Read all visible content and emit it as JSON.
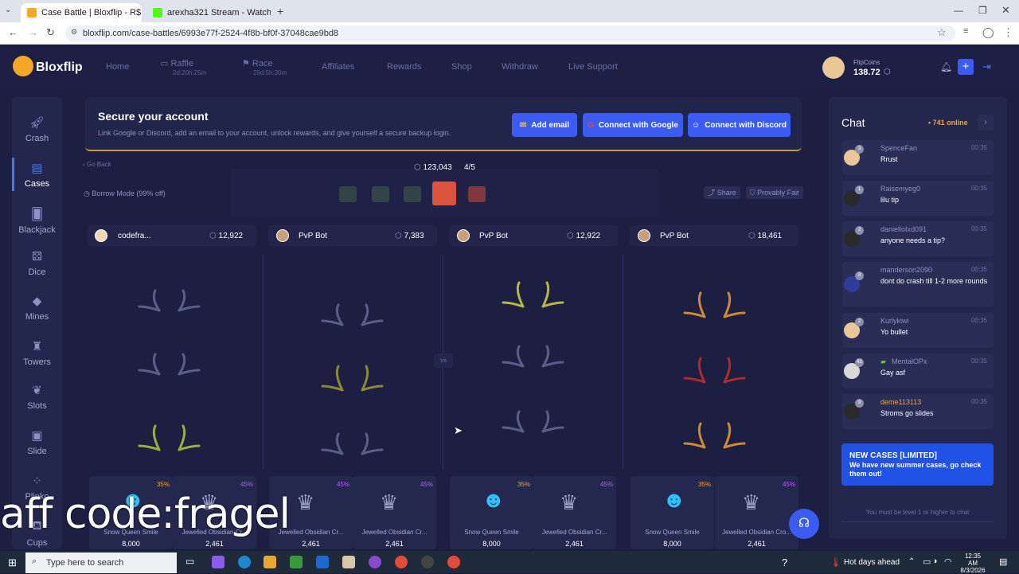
{
  "browser": {
    "tabs": [
      {
        "label": "Case Battle | Bloxflip - R$ S",
        "active": true
      },
      {
        "label": "arexha321 Stream - Watch Live",
        "active": false
      }
    ],
    "url": "bloxflip.com/case-battles/6993e77f-2524-4f8b-bf0f-37048cae9bd8"
  },
  "site": {
    "logo": "Bloxflip",
    "nav": [
      {
        "label": "Home"
      },
      {
        "label": "Raffle",
        "sub": "2d:20h:25m"
      },
      {
        "label": "Race",
        "sub": "29d:5h:20m"
      },
      {
        "label": "Affiliates"
      },
      {
        "label": "Rewards"
      },
      {
        "label": "Shop"
      },
      {
        "label": "Withdraw"
      },
      {
        "label": "Live Support"
      }
    ],
    "wallet": {
      "label": "FlipCoins",
      "amount": "138.72"
    },
    "sidebar": [
      {
        "label": "Crash",
        "icon": "rocket-icon"
      },
      {
        "label": "Cases",
        "icon": "case-icon",
        "active": true
      },
      {
        "label": "Blackjack",
        "icon": "cards-icon"
      },
      {
        "label": "Dice",
        "icon": "dice-icon"
      },
      {
        "label": "Mines",
        "icon": "gem-icon"
      },
      {
        "label": "Towers",
        "icon": "tower-icon"
      },
      {
        "label": "Slots",
        "icon": "cherry-icon"
      },
      {
        "label": "Slide",
        "icon": "slide-icon"
      },
      {
        "label": "Plinko",
        "icon": "plinko-icon"
      },
      {
        "label": "Cups",
        "icon": "cup-icon"
      }
    ],
    "secure": {
      "title": "Secure your account",
      "desc": "Link Google or Discord, add an email to your account, unlock rewards, and give yourself a secure backup login.",
      "btn_email": "Add email",
      "btn_google": "Connect with Google",
      "btn_discord": "Connect with Discord"
    },
    "battle": {
      "go_back": "Go Back",
      "total": "123,043",
      "round": "4/5",
      "borrow": "Borrow Mode (99% off)",
      "share": "Share",
      "fair": "Provably Fair",
      "vs": "vs",
      "players": [
        {
          "name": "codefra...",
          "value": "12,922"
        },
        {
          "name": "PvP Bot",
          "value": "7,383"
        },
        {
          "name": "PvP Bot",
          "value": "12,922"
        },
        {
          "name": "PvP Bot",
          "value": "18,461"
        }
      ],
      "items": [
        {
          "name": "Snow Queen Smile",
          "value": "8,000",
          "pct": "35%",
          "purple": false
        },
        {
          "name": "Jewelled Obsidian Cr...",
          "value": "2,461",
          "pct": "45%",
          "purple": true
        },
        {
          "name": "Jewelled Obsidian Cr...",
          "value": "2,461",
          "pct": "45%",
          "purple": true
        },
        {
          "name": "Jewelled Obsidian Cr...",
          "value": "2,461",
          "pct": "45%",
          "purple": true
        },
        {
          "name": "Snow Queen Smile",
          "value": "8,000",
          "pct": "35%",
          "purple": false
        },
        {
          "name": "Jewelled Obsidian Cr...",
          "value": "2,461",
          "pct": "45%",
          "purple": true
        },
        {
          "name": "Snow Queen Smile",
          "value": "8,000",
          "pct": "35%",
          "purple": false
        },
        {
          "name": "Jewelled Obsidian Cro...",
          "value": "2,461",
          "pct": "45%",
          "purple": true
        }
      ]
    },
    "chat": {
      "title": "Chat",
      "online": "741 online",
      "messages": [
        {
          "user": "SpenceFan",
          "lvl": "3",
          "time": "00:35",
          "text": "Rrust"
        },
        {
          "user": "Raisemyeg0",
          "lvl": "1",
          "time": "00:35",
          "text": "lilu tip"
        },
        {
          "user": "danielloIxd091",
          "lvl": "2",
          "time": "00:35",
          "text": "anyone needs a tip?"
        },
        {
          "user": "manderson2090",
          "lvl": "8",
          "time": "00:35",
          "text": "dont do crash till 1-2 more rounds"
        },
        {
          "user": "Kurlykiwi",
          "lvl": "2",
          "time": "00:35",
          "text": "Yo bullet"
        },
        {
          "user": "MentalOPx",
          "lvl": "43",
          "time": "00:35",
          "text": "Gay asf"
        },
        {
          "user": "deme113113",
          "lvl": "9",
          "time": "00:35",
          "text": "Stroms go slides"
        }
      ],
      "promo_title": "NEW CASES [LIMITED]",
      "promo_text": "We have new summer cases, go check them out!",
      "level_note": "You must be level 1 or higher to chat"
    }
  },
  "overlay": "aff code:fragel",
  "taskbar": {
    "search": "Type here to search",
    "weather": "Hot days ahead",
    "time": "12:35 AM",
    "date": "8/3/2026"
  }
}
